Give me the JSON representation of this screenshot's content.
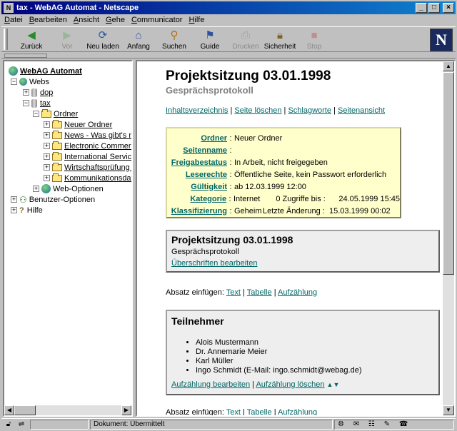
{
  "window": {
    "title": "tax - WebAG Automat - Netscape",
    "controls": [
      "_",
      "□",
      "×"
    ]
  },
  "menu": [
    {
      "label": "Datei",
      "key": "D",
      "rest": "atei"
    },
    {
      "label": "Bearbeiten",
      "key": "B",
      "rest": "earbeiten"
    },
    {
      "label": "Ansicht",
      "key": "A",
      "rest": "nsicht"
    },
    {
      "label": "Gehe",
      "key": "G",
      "rest": "ehe"
    },
    {
      "label": "Communicator",
      "key": "C",
      "rest": "ommunicator"
    },
    {
      "label": "Hilfe",
      "key": "H",
      "rest": "ilfe"
    }
  ],
  "toolbar": {
    "back": "Zurück",
    "forward": "Vor",
    "reload": "Neu laden",
    "home": "Anfang",
    "search": "Suchen",
    "guide": "Guide",
    "print": "Drucken",
    "security": "Sicherheit",
    "stop": "Stop",
    "logo": "N"
  },
  "tree": {
    "root": "WebAG Automat",
    "webs": "Webs",
    "dop": "dop",
    "tax": "tax",
    "ordner": "Ordner",
    "neuer_ordner": "Neuer Ordner",
    "news": "News - Was gibt's n",
    "electronic": "Electronic Commerc",
    "international": "International Service",
    "wirtschaft": "Wirtschaftsprüfung -",
    "kommunikation": "Kommunikationsdat",
    "weboptionen": "Web-Optionen",
    "benutzer": "Benutzer-Optionen",
    "hilfe": "Hilfe"
  },
  "page": {
    "title": "Projektsitzung 03.01.1998",
    "subtitle": "Gesprächsprotokoll",
    "nav": [
      "Inhaltsverzeichnis",
      "Seite löschen",
      "Schlagworte",
      "Seitenansicht"
    ],
    "separator": "|"
  },
  "meta": {
    "ordner_label": "Ordner",
    "ordner_value": "Neuer Ordner",
    "seitenname_label": "Seitenname",
    "seitenname_value": "",
    "freigabe_label": "Freigabestatus",
    "freigabe_value": "In Arbeit, nicht freigegeben",
    "leserechte_label": "Leserechte",
    "leserechte_value": "Öffentliche Seite, kein Passwort erforderlich",
    "gueltig_label": "Gültigkeit",
    "gueltig_value": "ab 12.03.1999 12:00",
    "kategorie_label": "Kategorie",
    "kategorie_value": "Internet",
    "kategorie_zugriffe": "0 Zugriffe bis :",
    "kategorie_date": "24.05.1999 15:45",
    "klass_label": "Klassifizierung",
    "klass_value": "Geheim",
    "klass_aenderung": "Letzte Änderung :",
    "klass_date": "15.03.1999 00:02",
    "colon": ":"
  },
  "heading_box": {
    "title": "Projektsitzung 03.01.1998",
    "sub": "Gesprächsprotokoll",
    "link": "Überschriften bearbeiten"
  },
  "absatz": {
    "label": "Absatz einfügen:",
    "text": "Text",
    "tabelle": "Tabelle",
    "aufzaehlung": "Aufzählung"
  },
  "teilnehmer": {
    "title": "Teilnehmer",
    "items": [
      "Alois Mustermann",
      "Dr. Annemarie Meier",
      "Karl Müller",
      "Ingo Schmidt (E-Mail: ingo.schmidt@webag.de)"
    ],
    "edit": "Aufzählung bearbeiten",
    "delete": "Aufzählung löschen"
  },
  "status": {
    "text": "Dokument: Übermittelt"
  }
}
